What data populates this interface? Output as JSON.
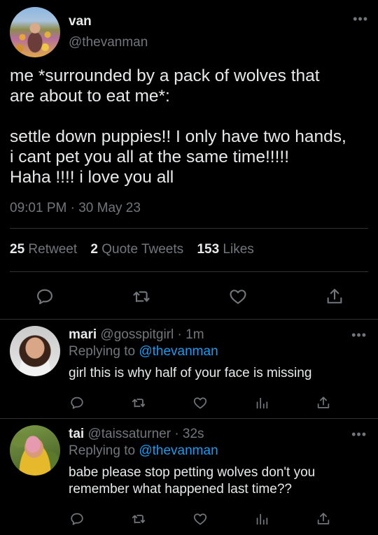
{
  "main_tweet": {
    "display_name": "van",
    "handle": "@thevanman",
    "text_lines_1": [
      "me *surrounded by a pack of wolves that",
      "are about to eat me*:"
    ],
    "text_lines_2": [
      "settle down puppies!! I only have two hands,",
      "i cant pet you all at the same time!!!!!",
      "Haha !!!! i love you all"
    ],
    "timestamp": "09:01 PM · 30 May 23",
    "stats": {
      "retweets_count": "25",
      "retweets_label": "Retweet",
      "quotes_count": "2",
      "quotes_label": "Quote Tweets",
      "likes_count": "153",
      "likes_label": "Likes"
    },
    "more_glyph": "•••"
  },
  "replies": [
    {
      "display_name": "mari",
      "handle": "@gosspitgirl",
      "time": "· 1m",
      "replying_prefix": "Replying to",
      "replying_to": "@thevanman",
      "text_lines": [
        "girl this is why half of your face is missing"
      ],
      "more_glyph": "•••"
    },
    {
      "display_name": "tai",
      "handle": "@taissaturner",
      "time": "· 32s",
      "replying_prefix": "Replying to",
      "replying_to": "@thevanman",
      "text_lines": [
        "babe please stop petting wolves don't you",
        "remember what happened last time??"
      ],
      "more_glyph": "•••"
    }
  ],
  "colors": {
    "background": "#000000",
    "text": "#e7e9ea",
    "muted": "#71767b",
    "link": "#1d9bf0",
    "divider": "#2f3336"
  },
  "icons": [
    "reply-icon",
    "retweet-icon",
    "like-icon",
    "analytics-icon",
    "share-icon",
    "more-icon"
  ]
}
